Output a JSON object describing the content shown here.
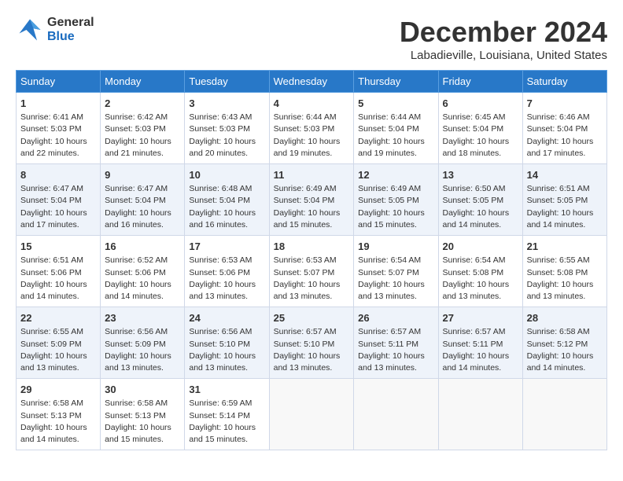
{
  "header": {
    "logo_general": "General",
    "logo_blue": "Blue",
    "month": "December 2024",
    "location": "Labadieville, Louisiana, United States"
  },
  "calendar": {
    "days_of_week": [
      "Sunday",
      "Monday",
      "Tuesday",
      "Wednesday",
      "Thursday",
      "Friday",
      "Saturday"
    ],
    "weeks": [
      [
        null,
        {
          "day": "2",
          "sunrise": "Sunrise: 6:42 AM",
          "sunset": "Sunset: 5:03 PM",
          "daylight": "Daylight: 10 hours and 21 minutes."
        },
        {
          "day": "3",
          "sunrise": "Sunrise: 6:43 AM",
          "sunset": "Sunset: 5:03 PM",
          "daylight": "Daylight: 10 hours and 20 minutes."
        },
        {
          "day": "4",
          "sunrise": "Sunrise: 6:44 AM",
          "sunset": "Sunset: 5:03 PM",
          "daylight": "Daylight: 10 hours and 19 minutes."
        },
        {
          "day": "5",
          "sunrise": "Sunrise: 6:44 AM",
          "sunset": "Sunset: 5:04 PM",
          "daylight": "Daylight: 10 hours and 19 minutes."
        },
        {
          "day": "6",
          "sunrise": "Sunrise: 6:45 AM",
          "sunset": "Sunset: 5:04 PM",
          "daylight": "Daylight: 10 hours and 18 minutes."
        },
        {
          "day": "7",
          "sunrise": "Sunrise: 6:46 AM",
          "sunset": "Sunset: 5:04 PM",
          "daylight": "Daylight: 10 hours and 17 minutes."
        }
      ],
      [
        {
          "day": "1",
          "sunrise": "Sunrise: 6:41 AM",
          "sunset": "Sunset: 5:03 PM",
          "daylight": "Daylight: 10 hours and 22 minutes."
        },
        {
          "day": "8",
          "sunrise": null,
          "sunset": null,
          "daylight": null
        },
        {
          "day": "9",
          "sunrise": null,
          "sunset": null,
          "daylight": null
        },
        {
          "day": "10",
          "sunrise": null,
          "sunset": null,
          "daylight": null
        },
        {
          "day": "11",
          "sunrise": null,
          "sunset": null,
          "daylight": null
        },
        {
          "day": "12",
          "sunrise": null,
          "sunset": null,
          "daylight": null
        },
        {
          "day": "13",
          "sunrise": null,
          "sunset": null,
          "daylight": null
        }
      ],
      [
        {
          "day": "15",
          "sunrise": "Sunrise: 6:51 AM",
          "sunset": "Sunset: 5:06 PM",
          "daylight": "Daylight: 10 hours and 14 minutes."
        },
        {
          "day": "16",
          "sunrise": "Sunrise: 6:52 AM",
          "sunset": "Sunset: 5:06 PM",
          "daylight": "Daylight: 10 hours and 14 minutes."
        },
        {
          "day": "17",
          "sunrise": "Sunrise: 6:53 AM",
          "sunset": "Sunset: 5:06 PM",
          "daylight": "Daylight: 10 hours and 13 minutes."
        },
        {
          "day": "18",
          "sunrise": "Sunrise: 6:53 AM",
          "sunset": "Sunset: 5:07 PM",
          "daylight": "Daylight: 10 hours and 13 minutes."
        },
        {
          "day": "19",
          "sunrise": "Sunrise: 6:54 AM",
          "sunset": "Sunset: 5:07 PM",
          "daylight": "Daylight: 10 hours and 13 minutes."
        },
        {
          "day": "20",
          "sunrise": "Sunrise: 6:54 AM",
          "sunset": "Sunset: 5:08 PM",
          "daylight": "Daylight: 10 hours and 13 minutes."
        },
        {
          "day": "21",
          "sunrise": "Sunrise: 6:55 AM",
          "sunset": "Sunset: 5:08 PM",
          "daylight": "Daylight: 10 hours and 13 minutes."
        }
      ],
      [
        {
          "day": "22",
          "sunrise": "Sunrise: 6:55 AM",
          "sunset": "Sunset: 5:09 PM",
          "daylight": "Daylight: 10 hours and 13 minutes."
        },
        {
          "day": "23",
          "sunrise": "Sunrise: 6:56 AM",
          "sunset": "Sunset: 5:09 PM",
          "daylight": "Daylight: 10 hours and 13 minutes."
        },
        {
          "day": "24",
          "sunrise": "Sunrise: 6:56 AM",
          "sunset": "Sunset: 5:10 PM",
          "daylight": "Daylight: 10 hours and 13 minutes."
        },
        {
          "day": "25",
          "sunrise": "Sunrise: 6:57 AM",
          "sunset": "Sunset: 5:10 PM",
          "daylight": "Daylight: 10 hours and 13 minutes."
        },
        {
          "day": "26",
          "sunrise": "Sunrise: 6:57 AM",
          "sunset": "Sunset: 5:11 PM",
          "daylight": "Daylight: 10 hours and 13 minutes."
        },
        {
          "day": "27",
          "sunrise": "Sunrise: 6:57 AM",
          "sunset": "Sunset: 5:11 PM",
          "daylight": "Daylight: 10 hours and 14 minutes."
        },
        {
          "day": "28",
          "sunrise": "Sunrise: 6:58 AM",
          "sunset": "Sunset: 5:12 PM",
          "daylight": "Daylight: 10 hours and 14 minutes."
        }
      ],
      [
        {
          "day": "29",
          "sunrise": "Sunrise: 6:58 AM",
          "sunset": "Sunset: 5:13 PM",
          "daylight": "Daylight: 10 hours and 14 minutes."
        },
        {
          "day": "30",
          "sunrise": "Sunrise: 6:58 AM",
          "sunset": "Sunset: 5:13 PM",
          "daylight": "Daylight: 10 hours and 15 minutes."
        },
        {
          "day": "31",
          "sunrise": "Sunrise: 6:59 AM",
          "sunset": "Sunset: 5:14 PM",
          "daylight": "Daylight: 10 hours and 15 minutes."
        },
        null,
        null,
        null,
        null
      ]
    ],
    "week2_data": [
      {
        "day": "8",
        "sunrise": "Sunrise: 6:47 AM",
        "sunset": "Sunset: 5:04 PM",
        "daylight": "Daylight: 10 hours and 17 minutes."
      },
      {
        "day": "9",
        "sunrise": "Sunrise: 6:47 AM",
        "sunset": "Sunset: 5:04 PM",
        "daylight": "Daylight: 10 hours and 16 minutes."
      },
      {
        "day": "10",
        "sunrise": "Sunrise: 6:48 AM",
        "sunset": "Sunset: 5:04 PM",
        "daylight": "Daylight: 10 hours and 16 minutes."
      },
      {
        "day": "11",
        "sunrise": "Sunrise: 6:49 AM",
        "sunset": "Sunset: 5:04 PM",
        "daylight": "Daylight: 10 hours and 15 minutes."
      },
      {
        "day": "12",
        "sunrise": "Sunrise: 6:49 AM",
        "sunset": "Sunset: 5:05 PM",
        "daylight": "Daylight: 10 hours and 15 minutes."
      },
      {
        "day": "13",
        "sunrise": "Sunrise: 6:50 AM",
        "sunset": "Sunset: 5:05 PM",
        "daylight": "Daylight: 10 hours and 14 minutes."
      },
      {
        "day": "14",
        "sunrise": "Sunrise: 6:51 AM",
        "sunset": "Sunset: 5:05 PM",
        "daylight": "Daylight: 10 hours and 14 minutes."
      }
    ]
  }
}
